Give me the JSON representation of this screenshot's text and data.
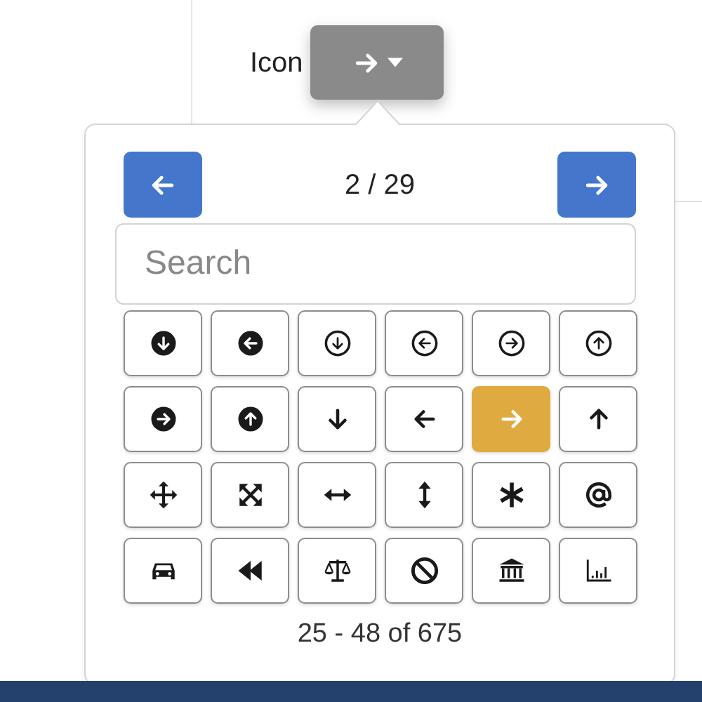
{
  "label": "Icon",
  "popover": {
    "page": "2 / 29",
    "search": {
      "placeholder": "Search"
    },
    "icons": [
      {
        "kind": "discdown",
        "selected": false
      },
      {
        "kind": "discleft",
        "selected": false
      },
      {
        "kind": "ringdown",
        "selected": false
      },
      {
        "kind": "ringleft",
        "selected": false
      },
      {
        "kind": "ringright",
        "selected": false
      },
      {
        "kind": "ringup",
        "selected": false
      },
      {
        "kind": "discright",
        "selected": false
      },
      {
        "kind": "discup",
        "selected": false
      },
      {
        "kind": "down",
        "selected": false
      },
      {
        "kind": "left",
        "selected": false
      },
      {
        "kind": "right",
        "selected": true
      },
      {
        "kind": "up",
        "selected": false
      },
      {
        "kind": "move",
        "selected": false
      },
      {
        "kind": "expand",
        "selected": false
      },
      {
        "kind": "horizontal",
        "selected": false
      },
      {
        "kind": "vertical",
        "selected": false
      },
      {
        "kind": "asterisk",
        "selected": false
      },
      {
        "kind": "at",
        "selected": false
      },
      {
        "kind": "car",
        "selected": false
      },
      {
        "kind": "rewind",
        "selected": false
      },
      {
        "kind": "scale",
        "selected": false
      },
      {
        "kind": "ban",
        "selected": false
      },
      {
        "kind": "bank",
        "selected": false
      },
      {
        "kind": "chart",
        "selected": false
      }
    ],
    "range": "25 - 48 of 675"
  }
}
